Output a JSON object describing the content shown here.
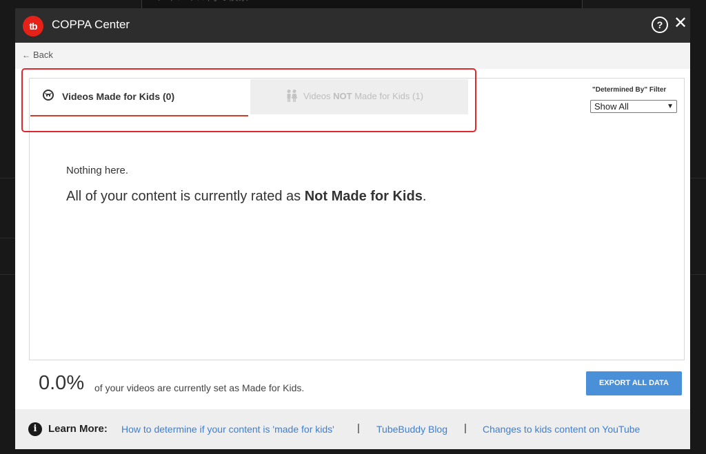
{
  "modal": {
    "title": "COPPA Center",
    "logo_text": "tb",
    "help_icon": "?",
    "close_icon": "✕",
    "back_label": "Back",
    "back_icon": "←"
  },
  "tabs": [
    {
      "label": "Videos Made for Kids",
      "count": "(0)",
      "active": true,
      "icon": "kid-face-icon"
    },
    {
      "label_prefix": "Videos ",
      "label_bold": "NOT",
      "label_suffix": " Made for Kids",
      "count": "(1)",
      "active": false,
      "icon": "people-icon"
    }
  ],
  "filter": {
    "label": "\"Determined By\" Filter",
    "selected": "Show All"
  },
  "empty_state": {
    "title": "Nothing here.",
    "message_prefix": "All of your content is currently rated as ",
    "message_bold": "Not Made for Kids",
    "message_suffix": "."
  },
  "stats": {
    "percent": "0.0%",
    "text": "of your videos are currently set as Made for Kids."
  },
  "export_button": "EXPORT ALL DATA",
  "footer": {
    "info_icon": "i",
    "learn_more": "Learn More:",
    "links": [
      "How to determine if your content is 'made for kids'",
      "TubeBuddy Blog",
      "Changes to kids content on YouTube"
    ],
    "separator": "|"
  },
  "background": {
    "search_placeholder": "チャンネル内で検索"
  },
  "colors": {
    "header_bg": "#2d2d2d",
    "accent_red": "#e62117",
    "highlight_red": "#e0262e",
    "link_blue": "#3c7fd1",
    "button_blue": "#4a90d9"
  }
}
